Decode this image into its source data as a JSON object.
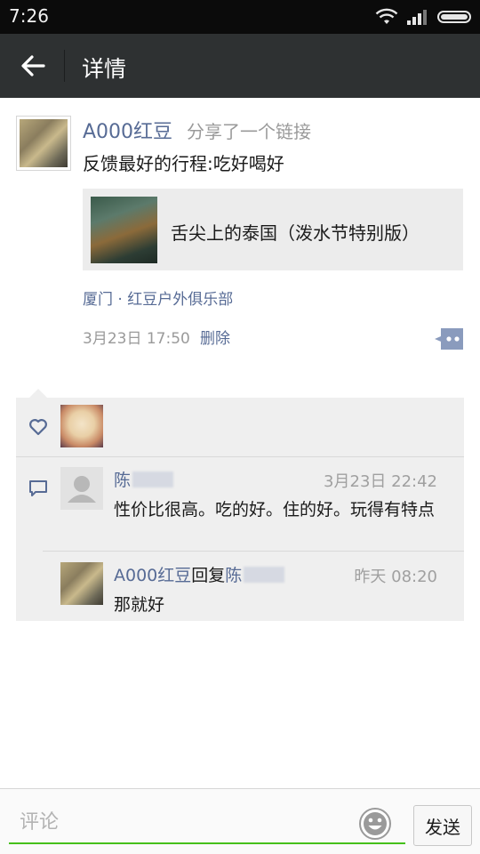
{
  "status_bar": {
    "time": "7:26",
    "icons": [
      "wifi-icon",
      "signal-icon",
      "battery-icon"
    ]
  },
  "header": {
    "back_icon": "arrow-left-icon",
    "title": "详情"
  },
  "post": {
    "username": "A000红豆",
    "action": "分享了一个链接",
    "text": "反馈最好的行程:吃好喝好",
    "link": {
      "title": "舌尖上的泰国（泼水节特别版）"
    },
    "location": "厦门 · 红豆户外俱乐部",
    "time": "3月23日 17:50",
    "delete_label": "删除",
    "more_icon": "comment-more-icon"
  },
  "likes": {
    "icon": "heart-icon"
  },
  "comments": [
    {
      "name": "陈",
      "time": "3月23日 22:42",
      "text": "性价比很高。吃的好。住的好。玩得有特点"
    },
    {
      "name": "A000红豆",
      "reply_word": "回复",
      "reply_to": "陈",
      "time": "昨天 08:20",
      "text": "那就好"
    }
  ],
  "bottom": {
    "placeholder": "评论",
    "send_label": "发送",
    "emoji_icon": "emoji-icon"
  },
  "colors": {
    "link_blue": "#576b95",
    "accent_green": "#45c01a",
    "title_bar": "#2e3132"
  }
}
